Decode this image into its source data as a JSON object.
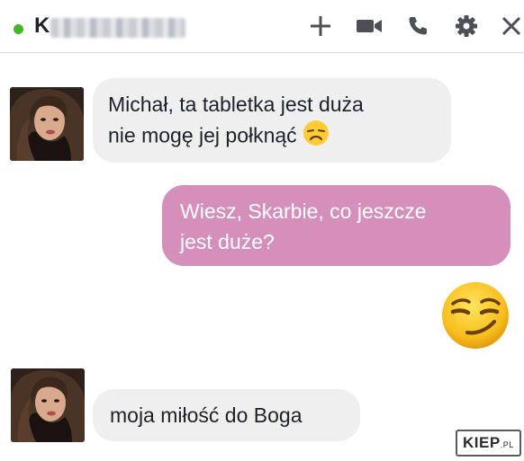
{
  "header": {
    "contact_initial": "K",
    "status": "online",
    "icons": [
      "plus-icon",
      "video-camera-icon",
      "phone-icon",
      "gear-icon",
      "close-icon"
    ]
  },
  "messages": [
    {
      "sender": "contact",
      "lines": [
        "Michał, ta tabletka jest duża",
        "nie mogę jej połknąć"
      ],
      "emoji": "disappointed-face"
    },
    {
      "sender": "me",
      "lines": [
        "Wiesz, Skarbie, co jeszcze",
        "jest duże?"
      ]
    },
    {
      "sender": "me",
      "emoji": "smirking-face"
    },
    {
      "sender": "contact",
      "lines": [
        "moja miłość do Boga"
      ]
    }
  ],
  "watermark": {
    "main": "KIEP",
    "suffix": ".PL"
  },
  "colors": {
    "outgoing_bubble": "#d58fbb",
    "incoming_bubble": "#efefef",
    "status_dot": "#42b72a"
  }
}
